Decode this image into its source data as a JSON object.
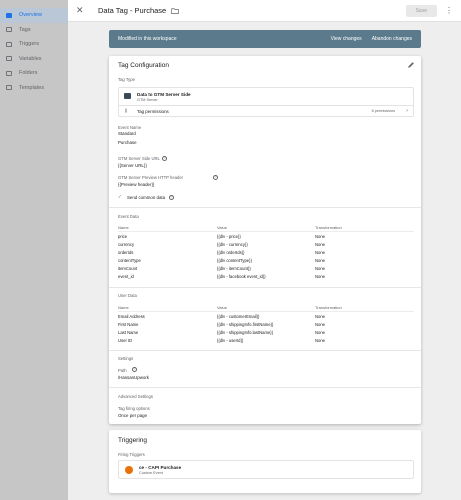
{
  "sidebar": {
    "items": [
      {
        "label": "Overview",
        "icon": "overview-icon",
        "active": true
      },
      {
        "label": "Tags",
        "icon": "tag-icon"
      },
      {
        "label": "Triggers",
        "icon": "trigger-icon"
      },
      {
        "label": "Variables",
        "icon": "variable-icon"
      },
      {
        "label": "Folders",
        "icon": "folder-icon"
      },
      {
        "label": "Templates",
        "icon": "template-icon"
      }
    ]
  },
  "header": {
    "title": "Data Tag - Purchase",
    "save_label": "Save",
    "more_glyph": "⋮",
    "close_glyph": "✕"
  },
  "banner": {
    "text": "Modified in this workspace",
    "view_changes": "View changes",
    "abandon_changes": "Abandon changes"
  },
  "config": {
    "title": "Tag Configuration",
    "tag_type_label": "Tag Type",
    "tag_type_name": "Data to GTM Server Side",
    "tag_type_sub": "GTM Server",
    "permissions_label": "Tag permissions",
    "permissions_count": "6 permissions",
    "event_name_label": "Event Name",
    "event_name_mode": "Standard",
    "event_name_value": "Purchase",
    "server_url_label": "GTM Server Side URL",
    "server_url_value": "{{Server URL}}",
    "preview_header_label": "GTM Server Preview HTTP header",
    "preview_header_value": "{{Preview header}}",
    "send_common_label": "Send common data",
    "event_data_label": "Event Data",
    "table_headers": [
      "Name",
      "Value",
      "Transformation"
    ],
    "event_data_rows": [
      [
        "price",
        "{{dlv - price}}",
        "None"
      ],
      [
        "currency",
        "{{dlv - currency}}",
        "None"
      ],
      [
        "orderIds",
        "{{dlv orderIds}}",
        "None"
      ],
      [
        "contentType",
        "{{dlv contentType}}",
        "None"
      ],
      [
        "itemCount",
        "{{dlv - itemCount}}",
        "None"
      ],
      [
        "event_id",
        "{{dlv - facebook event_id}}",
        "None"
      ]
    ],
    "user_data_label": "User Data",
    "user_data_rows": [
      [
        "Email Address",
        "{{dlv - customerEmail}}",
        "None"
      ],
      [
        "First Name",
        "{{dlv - shippingInfo.firstName}}",
        "None"
      ],
      [
        "Last Name",
        "{{dlv - shippingInfo.lastName}}",
        "None"
      ],
      [
        "User ID",
        "{{dlv - userId}}",
        "None"
      ]
    ],
    "settings_label": "Settings",
    "path_label": "Path",
    "path_value": "/HassanUpwork",
    "advanced_label": "Advanced Settings",
    "firing_options_label": "Tag firing options",
    "firing_options_value": "Once per page"
  },
  "triggering": {
    "title": "Triggering",
    "firing_label": "Firing Triggers",
    "trigger_name": "ce - CAPI Purchase",
    "trigger_type": "Custom Event"
  },
  "colors": {
    "banner": "#5b7b8c",
    "accent": "#1a73e8",
    "trigger_icon": "#e8710a"
  }
}
